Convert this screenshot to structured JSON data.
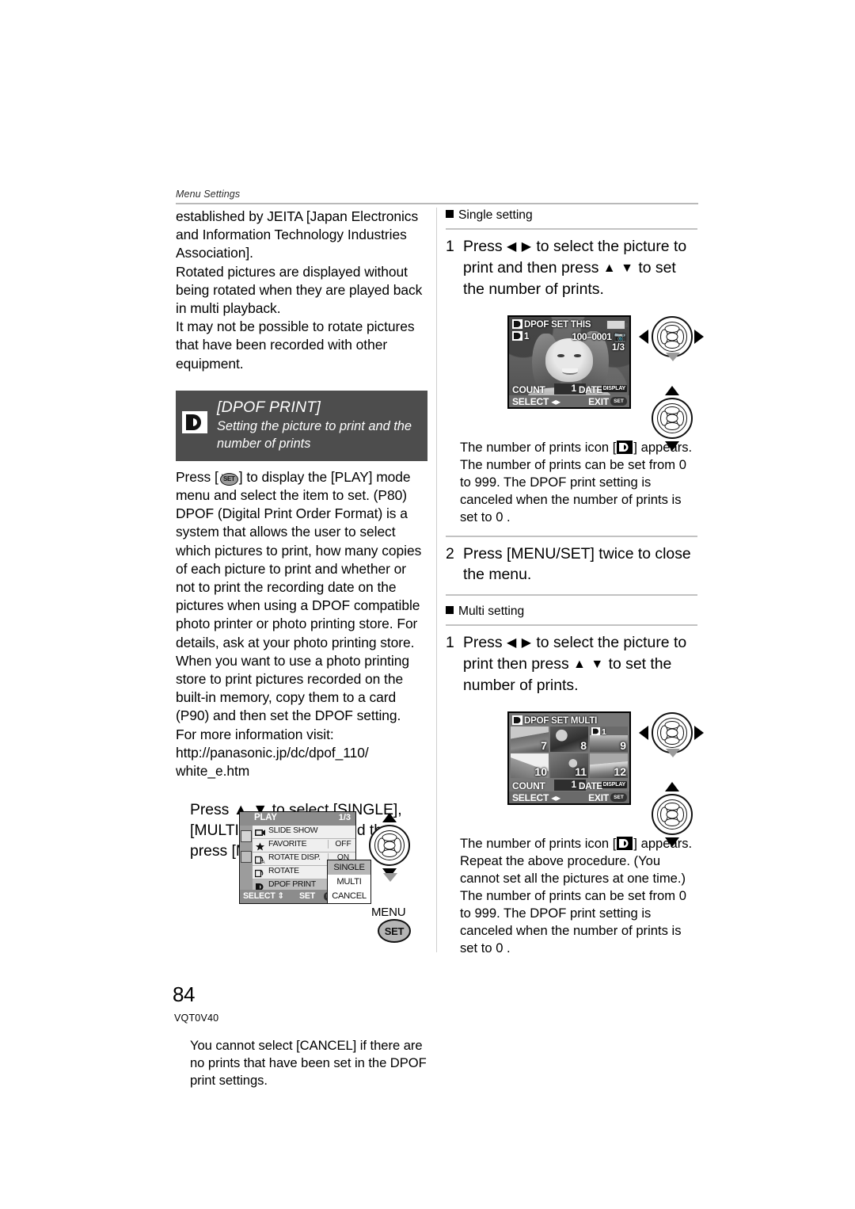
{
  "running_head": "Menu Settings",
  "left_column": {
    "intro_paragraphs": [
      "established by JEITA [Japan Electronics and Information Technology Industries Association].",
      "Rotated pictures are displayed without being rotated when they are played back in multi playback.",
      "It may not be possible to rotate pictures that have been recorded with other equipment."
    ],
    "banner": {
      "title": "[DPOF PRINT]",
      "subtitle_line1": "Setting the picture to print and the",
      "subtitle_line2": "number of prints",
      "icon": "dpof-icon"
    },
    "body_before_icon": "Press [",
    "body_after_icon": "] to display the [PLAY] mode menu and select the item to set. (P80)",
    "body_paragraphs": [
      "DPOF (Digital Print Order Format) is a system that allows the user to select which pictures to print, how many copies of each picture to print and whether or not to print the recording date on the pictures when using a DPOF compatible photo printer or photo printing store. For details, ask at your photo printing store.",
      "When you want to use a photo printing store to print pictures recorded on the built-in memory, copy them to a card (P90) and then set the DPOF setting.",
      "For more information visit:",
      "http://panasonic.jp/dc/dpof_110/",
      "white_e.htm"
    ],
    "instruction": "Press ▲ ▼ to select [SINGLE], [MULTI] or [CANCEL] and then press [MENU/SET].",
    "play_menu": {
      "title": "PLAY",
      "page_indicator": "1/3",
      "rows": [
        {
          "icon": "slideshow-icon",
          "label": "SLIDE SHOW",
          "value": ""
        },
        {
          "icon": "star-icon",
          "label": "FAVORITE",
          "value": "OFF"
        },
        {
          "icon": "rotate-disp-icon",
          "label": "ROTATE DISP.",
          "value": "ON"
        },
        {
          "icon": "rotate-icon",
          "label": "ROTATE",
          "value": ""
        },
        {
          "icon": "dpof-icon",
          "label": "DPOF PRINT",
          "value": ""
        }
      ],
      "popup_options": [
        "SINGLE",
        "MULTI",
        "CANCEL"
      ],
      "popup_selected": "SINGLE",
      "footer_select": "SELECT",
      "footer_set": "SET",
      "footer_set_glyph": "SET",
      "tabs": [
        "play-tab-icon",
        "setup-tab-icon"
      ]
    },
    "dpad_label_menu": "MENU",
    "dpad_label_set": "SET",
    "closing_note": "You cannot select [CANCEL] if there are no prints that have been set in the DPOF print settings."
  },
  "right_column": {
    "single": {
      "heading": "Single setting",
      "step_number": "1",
      "step_text_a": "Press",
      "step_arrows_lr": "◀ ▶",
      "step_text_b": "to select the picture to print and then press",
      "step_arrows_ud": "▲ ▼",
      "step_text_c": "to set the number of prints.",
      "lcd": {
        "title": "DPOF SET THIS",
        "print_count_badge": "1",
        "file_number": "100–0001",
        "frame": "1/3",
        "count_label": "COUNT",
        "count_value": "1",
        "date_label": "DATE",
        "date_button": "DISPLAY",
        "select_label": "SELECT",
        "exit_label": "EXIT",
        "exit_button": "SET"
      },
      "notes": [
        "The number of prints icon [",
        "] appears.",
        "The number of prints can be set from 0 to 999. The DPOF print setting is canceled when the number of prints is set to  0 ."
      ],
      "step2_number": "2",
      "step2_text": "Press [MENU/SET] twice to close the menu."
    },
    "multi": {
      "heading": "Multi setting",
      "step_number": "1",
      "step_text_a": "Press",
      "step_arrows_lr": "◀ ▶",
      "step_text_b": "to select the picture to print then press",
      "step_arrows_ud": "▲ ▼",
      "step_text_c": "to set the number of prints.",
      "lcd": {
        "title": "DPOF SET MULTI",
        "thumbnails": [
          {
            "number": "7",
            "badge": ""
          },
          {
            "number": "8",
            "badge": ""
          },
          {
            "number": "9",
            "badge": "1"
          },
          {
            "number": "10",
            "badge": ""
          },
          {
            "number": "11",
            "badge": ""
          },
          {
            "number": "12",
            "badge": ""
          }
        ],
        "count_label": "COUNT",
        "count_value": "1",
        "date_label": "DATE",
        "date_button": "DISPLAY",
        "select_label": "SELECT",
        "exit_label": "EXIT",
        "exit_button": "SET"
      },
      "notes": [
        "The number of prints icon [",
        "] appears.",
        "Repeat the above procedure. (You cannot set all the pictures at one time.)",
        "The number of prints can be set from 0 to 999. The DPOF print setting is canceled when the number of prints is set to  0 ."
      ]
    }
  },
  "footer": {
    "page_number": "84",
    "doc_code": "VQT0V40"
  }
}
